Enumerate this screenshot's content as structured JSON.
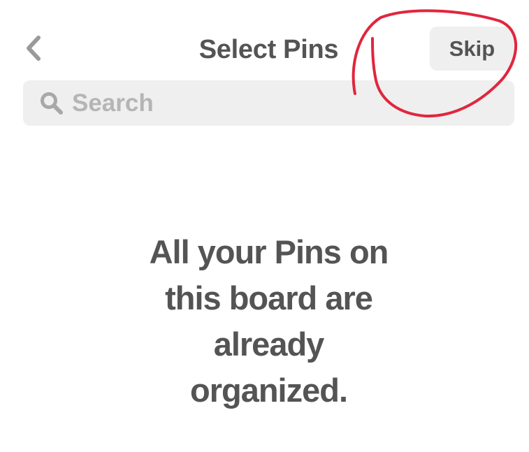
{
  "header": {
    "title": "Select Pins",
    "back_icon": "chevron-left-icon",
    "skip_label": "Skip"
  },
  "search": {
    "icon": "search-icon",
    "placeholder": "Search",
    "value": ""
  },
  "empty_state": {
    "lines": [
      "All your Pins on",
      "this board are",
      "already",
      "organized."
    ]
  },
  "colors": {
    "text": "#545454",
    "muted": "#b5b5b5",
    "surface": "#efefef",
    "annotation": "#e0263e"
  }
}
